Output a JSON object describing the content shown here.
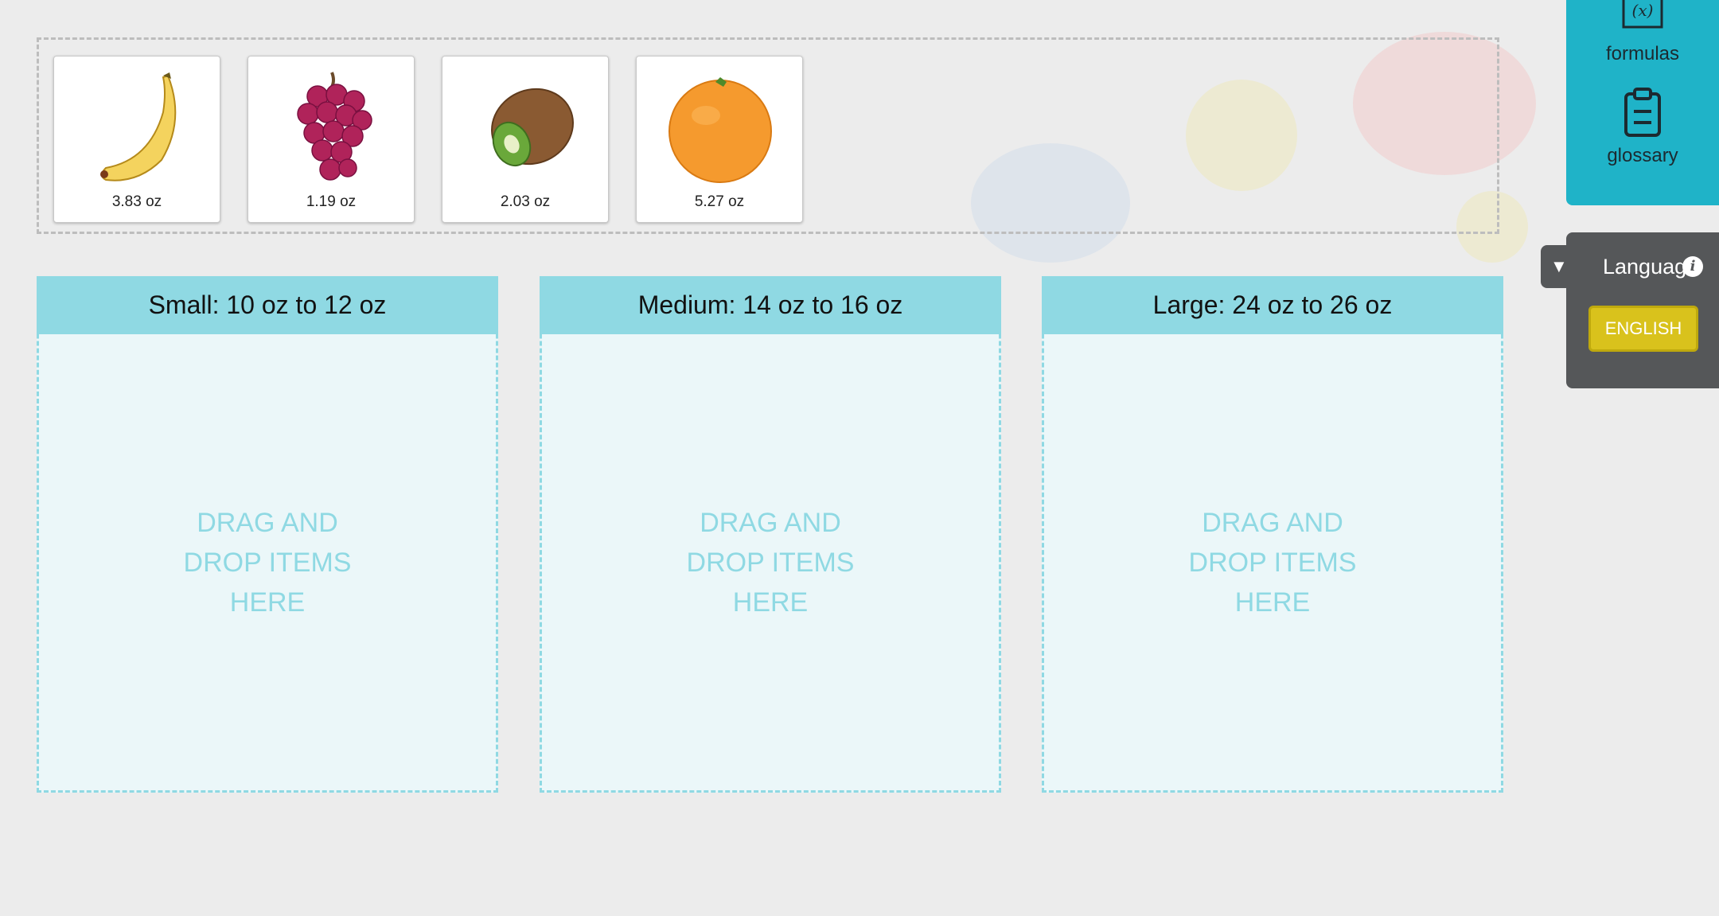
{
  "items": [
    {
      "name": "banana",
      "weight": "3.83 oz"
    },
    {
      "name": "grapes",
      "weight": "1.19 oz"
    },
    {
      "name": "kiwi",
      "weight": "2.03 oz"
    },
    {
      "name": "orange",
      "weight": "5.27 oz"
    }
  ],
  "bins": [
    {
      "label": "Small: 10 oz to 12 oz",
      "hint": "DRAG AND\nDROP ITEMS\nHERE"
    },
    {
      "label": "Medium: 14 oz to 16 oz",
      "hint": "DRAG AND\nDROP ITEMS\nHERE"
    },
    {
      "label": "Large: 24 oz to 26 oz",
      "hint": "DRAG AND\nDROP ITEMS\nHERE"
    }
  ],
  "tools": {
    "formulas_label": "formulas",
    "glossary_label": "glossary"
  },
  "language": {
    "label": "Language",
    "info_glyph": "i",
    "current": "ENGLISH"
  },
  "colors": {
    "bin_accent": "#8fd9e3",
    "tools_bg": "#1fb3c8",
    "language_button": "#d9c21c"
  }
}
